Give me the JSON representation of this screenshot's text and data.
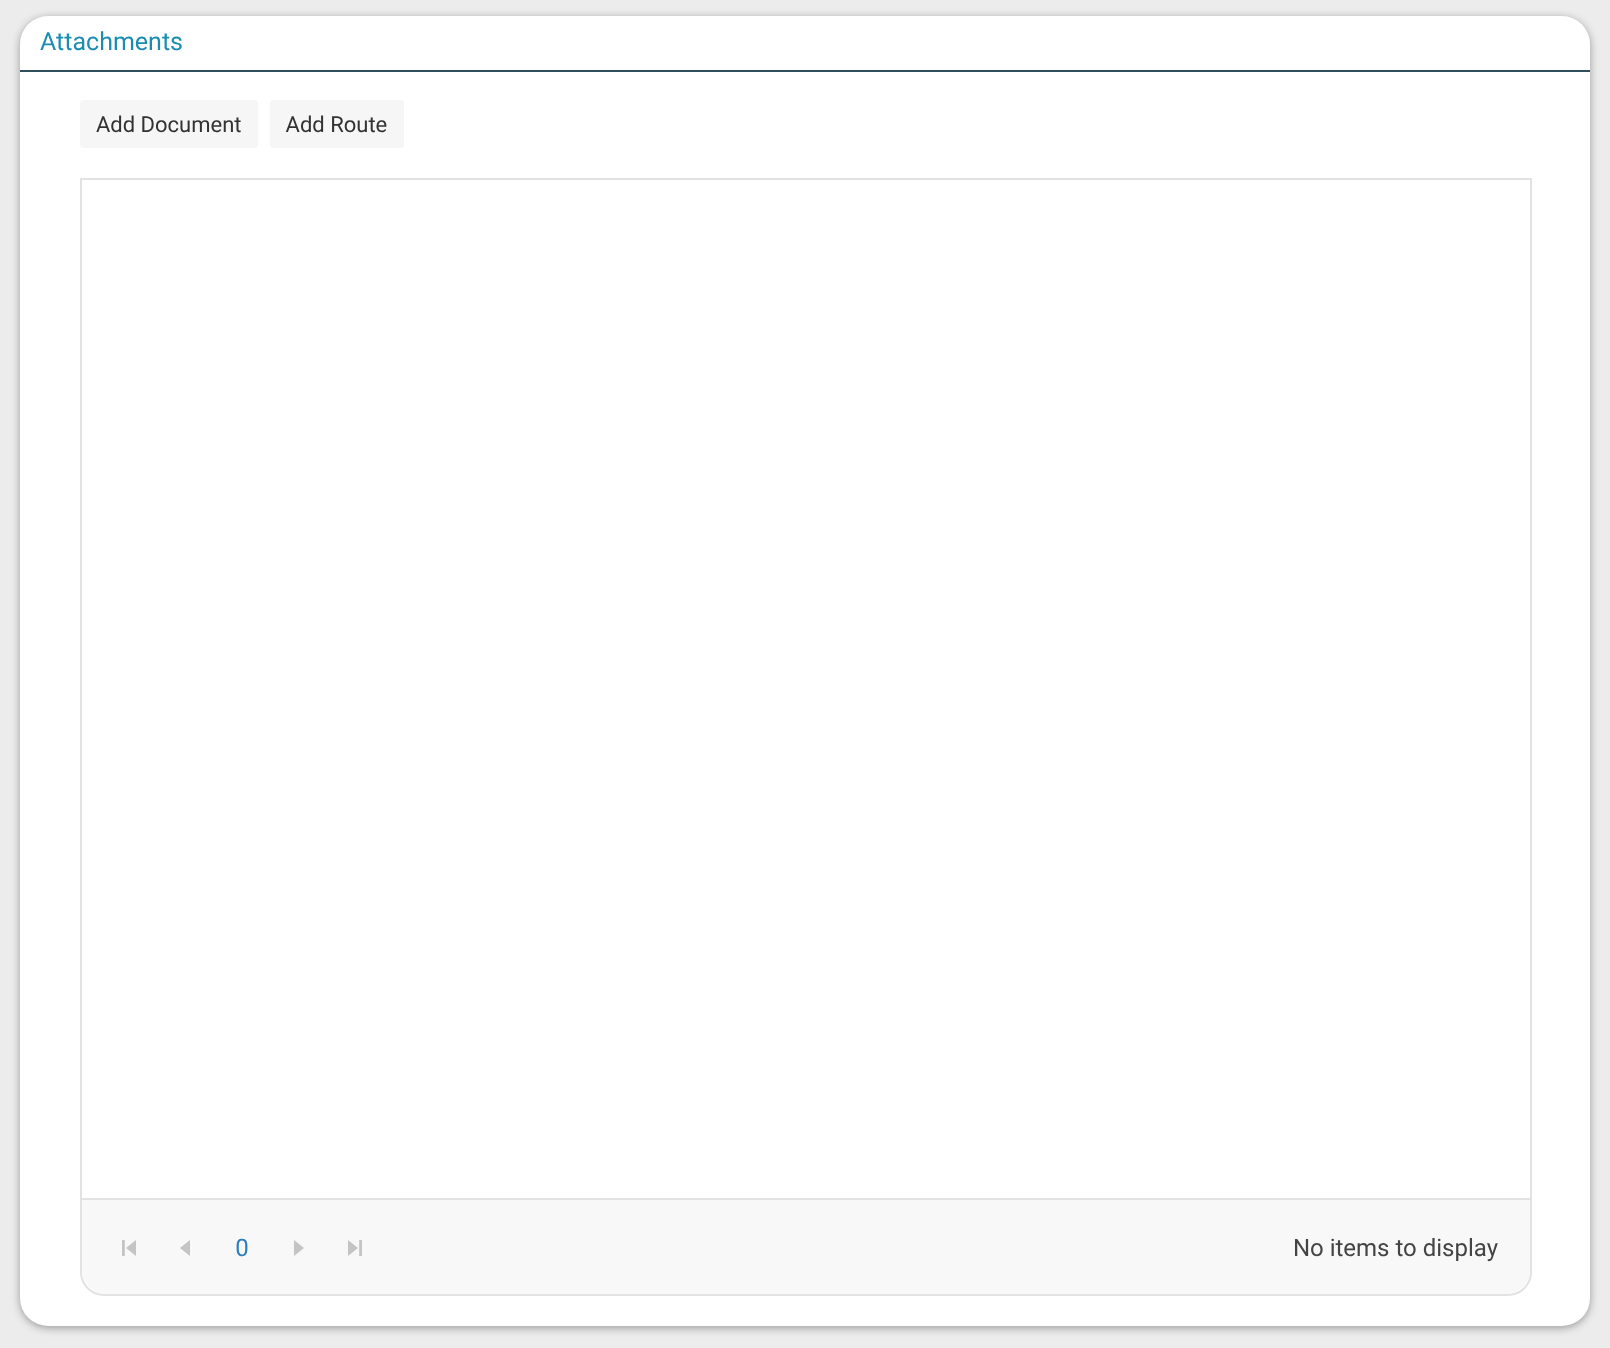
{
  "panel": {
    "title": "Attachments"
  },
  "toolbar": {
    "buttons": [
      "Add Document",
      "Add Route"
    ]
  },
  "pager": {
    "nav": [
      {
        "kind": "first",
        "disabled": true
      },
      {
        "kind": "prev",
        "disabled": true
      },
      {
        "kind": "page",
        "label": "0"
      },
      {
        "kind": "next",
        "disabled": true
      },
      {
        "kind": "last",
        "disabled": true
      }
    ],
    "info": "No items to display"
  }
}
